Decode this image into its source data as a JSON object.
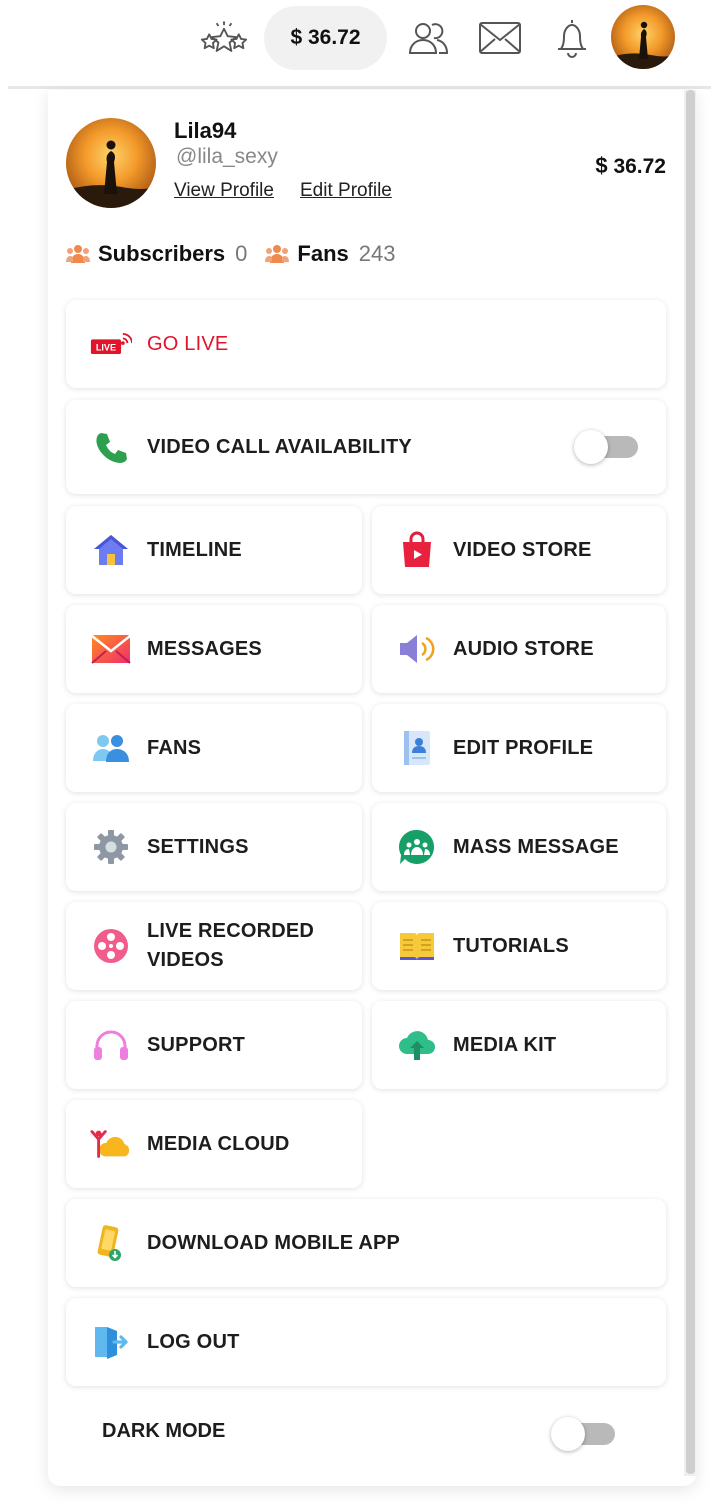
{
  "topbar": {
    "balance": "$ 36.72",
    "icons": [
      "stars-icon",
      "users-icon",
      "mail-icon",
      "bell-icon"
    ]
  },
  "profile": {
    "username": "Lila94",
    "handle": "@lila_sexy",
    "view_profile": "View Profile",
    "edit_profile": "Edit Profile",
    "balance_symbol": "$",
    "balance_value": "36.72"
  },
  "stats": {
    "subscribers_label": "Subscribers",
    "subscribers_value": "0",
    "fans_label": "Fans",
    "fans_value": "243"
  },
  "menu": {
    "go_live": "GO LIVE",
    "video_call": "VIDEO CALL AVAILABILITY",
    "timeline": "TIMELINE",
    "video_store": "VIDEO STORE",
    "messages": "MESSAGES",
    "audio_store": "AUDIO STORE",
    "fans": "FANS",
    "edit_profile": "EDIT PROFILE",
    "settings": "SETTINGS",
    "mass_message": "MASS MESSAGE",
    "live_recorded_line1": "LIVE RECORDED",
    "live_recorded_line2": "VIDEOS",
    "tutorials": "TUTORIALS",
    "support": "SUPPORT",
    "media_kit": "MEDIA KIT",
    "media_cloud": "MEDIA CLOUD",
    "download_app": "DOWNLOAD MOBILE APP",
    "log_out": "LOG OUT",
    "dark_mode": "DARK MODE",
    "live_badge": "LIVE"
  },
  "toggles": {
    "video_call_on": false,
    "dark_mode_on": false
  },
  "colors": {
    "go_live_red": "#e0142a",
    "toggle_off": "#b9b9b9",
    "pill_bg": "#f1f1f1"
  }
}
